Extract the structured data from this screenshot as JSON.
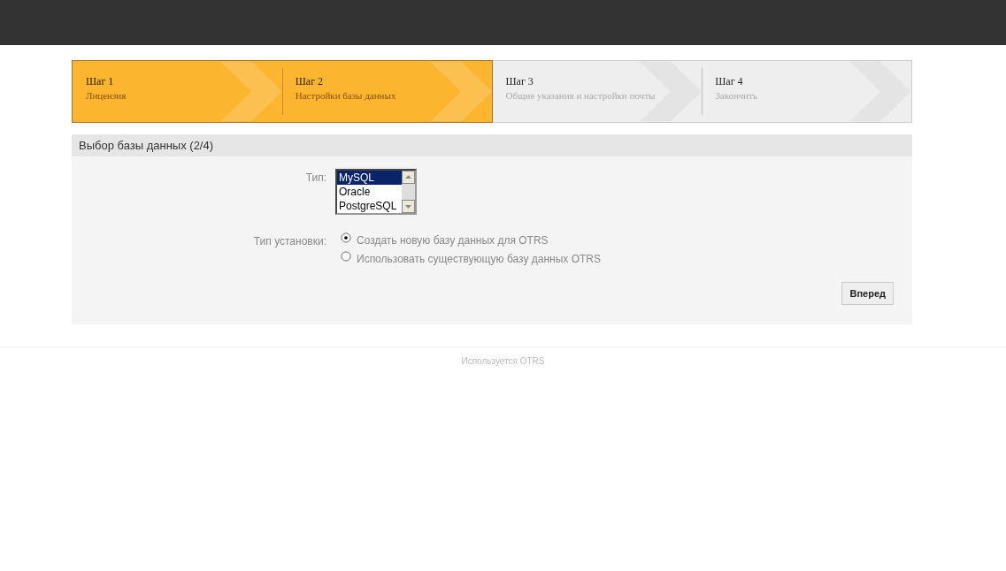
{
  "steps": [
    {
      "title": "Шаг 1",
      "subtitle": "Лицензия",
      "done": true
    },
    {
      "title": "Шаг 2",
      "subtitle": "Настройки базы данных",
      "done": true
    },
    {
      "title": "Шаг 3",
      "subtitle": "Общие указания и настройки почты",
      "done": false
    },
    {
      "title": "Шаг 4",
      "subtitle": "Закончить",
      "done": false
    }
  ],
  "panel": {
    "title": "Выбор базы данных (2/4)",
    "type_label": "Тип:",
    "type_options": [
      {
        "label": "MySQL",
        "selected": true
      },
      {
        "label": "Oracle",
        "selected": false
      },
      {
        "label": "PostgreSQL",
        "selected": false
      }
    ],
    "install_label": "Тип установки:",
    "install_options": [
      {
        "label": "Создать новую базу данных для OTRS",
        "selected": true
      },
      {
        "label": "Использовать существующую базу данных OTRS",
        "selected": false
      }
    ],
    "next_button": "Вперед"
  },
  "footer": "Используется OTRS"
}
